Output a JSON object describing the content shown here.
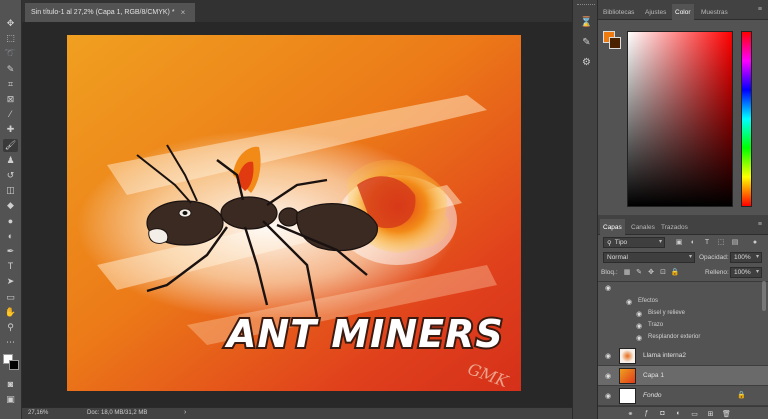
{
  "document": {
    "tab_title": "Sin título-1 al 27,2% (Capa 1, RGB/8/CMYK) *",
    "close_glyph": "×"
  },
  "status": {
    "zoom": "27,16%",
    "doc_info": "Doc: 18,0 MB/31,2 MB",
    "arrow": "›"
  },
  "artwork": {
    "headline": "ANT MINERS",
    "signature": "GMK"
  },
  "toolbar": {
    "tools": [
      {
        "name": "move-tool-icon",
        "glyph": "✥"
      },
      {
        "name": "marquee-tool-icon",
        "glyph": "⬚"
      },
      {
        "name": "lasso-tool-icon",
        "glyph": "➰"
      },
      {
        "name": "quick-select-tool-icon",
        "glyph": "✎"
      },
      {
        "name": "crop-tool-icon",
        "glyph": "⌗"
      },
      {
        "name": "frame-tool-icon",
        "glyph": "⊠"
      },
      {
        "name": "eyedropper-tool-icon",
        "glyph": "⁄"
      },
      {
        "name": "healing-tool-icon",
        "glyph": "✚"
      },
      {
        "name": "brush-tool-icon",
        "glyph": "🖌"
      },
      {
        "name": "stamp-tool-icon",
        "glyph": "♟"
      },
      {
        "name": "history-brush-tool-icon",
        "glyph": "↺"
      },
      {
        "name": "eraser-tool-icon",
        "glyph": "◫"
      },
      {
        "name": "paint-bucket-tool-icon",
        "glyph": "◆"
      },
      {
        "name": "blur-tool-icon",
        "glyph": "●"
      },
      {
        "name": "dodge-tool-icon",
        "glyph": "◐"
      },
      {
        "name": "pen-tool-icon",
        "glyph": "✒"
      },
      {
        "name": "type-tool-icon",
        "glyph": "T"
      },
      {
        "name": "path-select-tool-icon",
        "glyph": "➤"
      },
      {
        "name": "shape-tool-icon",
        "glyph": "▭"
      },
      {
        "name": "hand-tool-icon",
        "glyph": "✋"
      },
      {
        "name": "zoom-tool-icon",
        "glyph": "⚲"
      },
      {
        "name": "more-tools-icon",
        "glyph": "⋯"
      }
    ],
    "bottom": [
      {
        "name": "quick-mask-icon",
        "glyph": "◙"
      },
      {
        "name": "screen-mode-icon",
        "glyph": "▣"
      }
    ]
  },
  "icon_column": [
    {
      "name": "history-panel-icon",
      "glyph": "⌛"
    },
    {
      "name": "brush-settings-icon",
      "glyph": "✎"
    },
    {
      "name": "properties-panel-icon",
      "glyph": "⚙"
    }
  ],
  "color_panel": {
    "tabs": [
      "Bibliotecas",
      "Ajustes",
      "Color",
      "Muestras"
    ],
    "active_tab": 2,
    "foreground": "#ee7a10",
    "background": "#4a2200",
    "menu_glyph": "≡"
  },
  "layers_panel": {
    "tabs": [
      "Capas",
      "Canales",
      "Trazados"
    ],
    "active_tab": 0,
    "menu_glyph": "≡",
    "filter_kind": "Tipo",
    "blend_mode": "Normal",
    "opacity_label": "Opacidad:",
    "opacity_value": "100%",
    "lock_label": "Bloq.:",
    "fill_label": "Relleno:",
    "fill_value": "100%",
    "effects": {
      "header": "Efectos",
      "items": [
        "Bisel y relieve",
        "Trazo",
        "Resplandor exterior"
      ]
    },
    "layers": [
      {
        "name": "Llama interna2",
        "selected": false,
        "italic": false
      },
      {
        "name": "Capa 1",
        "selected": true,
        "italic": false
      },
      {
        "name": "Fondo",
        "selected": false,
        "italic": true
      }
    ]
  },
  "colors": {
    "chrome_dark": "#282828",
    "chrome_mid": "#535353",
    "panel_tab": "#424242",
    "accent_orange": "#ee7a10"
  }
}
